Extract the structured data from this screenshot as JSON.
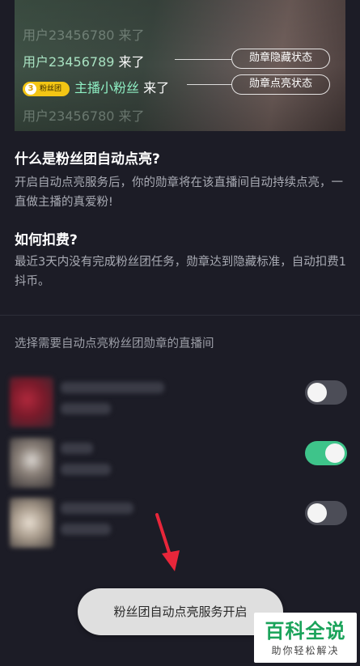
{
  "banner": {
    "lines": [
      {
        "user": "用户23456780",
        "verb": "来了"
      },
      {
        "user": "用户23456789",
        "verb": "来了"
      },
      {
        "badge_level": "3",
        "badge_text": "粉丝团",
        "anchor": "主播小粉丝",
        "verb": "来了"
      },
      {
        "user": "用户23456780",
        "verb": "来了"
      }
    ],
    "pill_hidden": "勋章隐藏状态",
    "pill_lit": "勋章点亮状态"
  },
  "faq": {
    "q1": "什么是粉丝团自动点亮?",
    "a1": "开启自动点亮服务后，你的勋章将在该直播间自动持续点亮，一直做主播的真爱粉!",
    "q2": "如何扣费?",
    "a2": "最近3天内没有完成粉丝团任务，勋章达到隐藏标准，自动扣费1抖币。"
  },
  "rooms": {
    "label": "选择需要自动点亮粉丝团勋章的直播间",
    "items": [
      {
        "enabled": false
      },
      {
        "enabled": true
      },
      {
        "enabled": false
      }
    ]
  },
  "toast": "粉丝团自动点亮服务开启",
  "watermark": {
    "main": "百科全说",
    "sub": "助你轻松解决"
  },
  "colors": {
    "background": "#1c1c26",
    "toggle_on": "#3ec48a",
    "toggle_off": "#4c4d57",
    "anchor_name": "#8ff0c4",
    "badge": "#f3c514",
    "arrow": "#e8263a",
    "watermark_green": "#1aa35a"
  }
}
